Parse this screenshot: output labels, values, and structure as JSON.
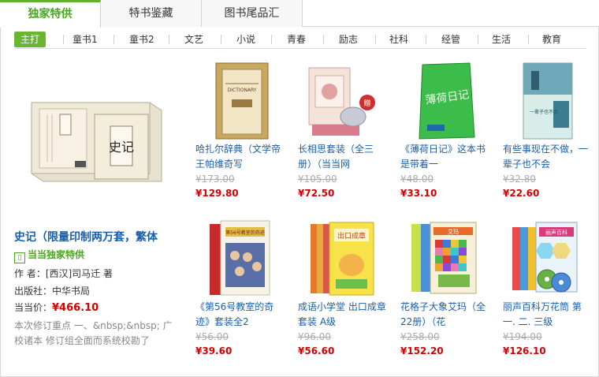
{
  "tabs": [
    {
      "label": "独家特供"
    },
    {
      "label": "特书鉴藏"
    },
    {
      "label": "图书尾品汇"
    }
  ],
  "categories": [
    "主打",
    "童书1",
    "童书2",
    "文艺",
    "小说",
    "青春",
    "励志",
    "社科",
    "经管",
    "生活",
    "教育"
  ],
  "featured": {
    "title": "史记（限量印制两万套，繁体",
    "badge_icon": "dangdang-logo-icon",
    "badge": "当当独家特供",
    "author": "作 者：[西汉]司马迁 著",
    "publisher": "出版社：中华书局",
    "price_label": "当当价：",
    "price": "¥466.10",
    "desc": "本次修订重点 一、&nbsp;&nbsp; 广校诸本 修订组全面而系统校勘了"
  },
  "products": [
    {
      "name": "哈扎尔辞典（文学帝王帕维奇写",
      "old_price": "¥173.00",
      "price": "¥129.80"
    },
    {
      "name": "长相思套装（全三册）（当当网",
      "old_price": "¥105.00",
      "price": "¥72.50"
    },
    {
      "name": "《薄荷日记》这本书是带着一",
      "old_price": "¥48.00",
      "price": "¥33.10"
    },
    {
      "name": "有些事现在不做，一辈子也不会",
      "old_price": "¥32.80",
      "price": "¥22.60"
    },
    {
      "name": "《第56号教室的奇迹》套装全2",
      "old_price": "¥56.00",
      "price": "¥39.60"
    },
    {
      "name": "成语小学堂 出口成章套装 A级",
      "old_price": "¥96.00",
      "price": "¥56.60"
    },
    {
      "name": "花格子大象艾玛（全22册）（花",
      "old_price": "¥258.00",
      "price": "¥152.20"
    },
    {
      "name": "丽声百科万花筒 第一. 二. 三级",
      "old_price": "¥194.00",
      "price": "¥126.10"
    }
  ],
  "cover_text": {
    "featured_spine": "史记",
    "p1": "DICTIONARY",
    "p2": "赠",
    "p3": "薄荷日记",
    "p4": "一辈子也不会",
    "p5": "第56号教室的奇迹",
    "p6": "出口成章",
    "p7": "艾玛",
    "p8": "丽声百科"
  },
  "colors": {
    "accent_green": "#63b12c",
    "link_blue": "#1a5ea8",
    "price_red": "#d60000"
  }
}
